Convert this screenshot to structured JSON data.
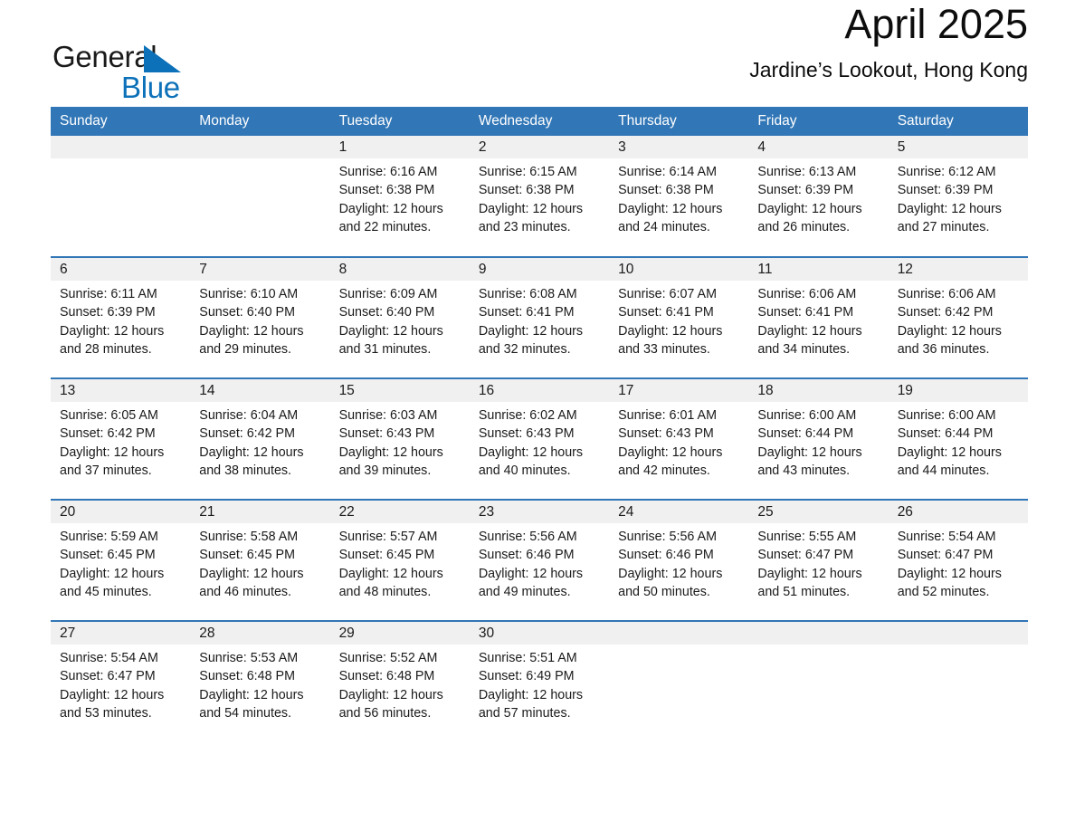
{
  "brand": {
    "name_part1": "General",
    "name_part2": "Blue",
    "accent_color": "#0c71b9"
  },
  "header": {
    "title": "April 2025",
    "location": "Jardine’s Lookout, Hong Kong",
    "header_bg_color": "#3176b6",
    "daynum_bg_color": "#f0f0f0"
  },
  "weekday_headers": [
    "Sunday",
    "Monday",
    "Tuesday",
    "Wednesday",
    "Thursday",
    "Friday",
    "Saturday"
  ],
  "weeks": [
    [
      {
        "day": "",
        "empty": true
      },
      {
        "day": "",
        "empty": true
      },
      {
        "day": "1",
        "sunrise": "Sunrise: 6:16 AM",
        "sunset": "Sunset: 6:38 PM",
        "daylight": "Daylight: 12 hours and 22 minutes.",
        "text": "Sunrise: 6:16 AM\nSunset: 6:38 PM\nDaylight: 12 hours\nand 22 minutes."
      },
      {
        "day": "2",
        "sunrise": "Sunrise: 6:15 AM",
        "sunset": "Sunset: 6:38 PM",
        "daylight": "Daylight: 12 hours and 23 minutes.",
        "text": "Sunrise: 6:15 AM\nSunset: 6:38 PM\nDaylight: 12 hours\nand 23 minutes."
      },
      {
        "day": "3",
        "sunrise": "Sunrise: 6:14 AM",
        "sunset": "Sunset: 6:38 PM",
        "daylight": "Daylight: 12 hours and 24 minutes.",
        "text": "Sunrise: 6:14 AM\nSunset: 6:38 PM\nDaylight: 12 hours\nand 24 minutes."
      },
      {
        "day": "4",
        "sunrise": "Sunrise: 6:13 AM",
        "sunset": "Sunset: 6:39 PM",
        "daylight": "Daylight: 12 hours and 26 minutes.",
        "text": "Sunrise: 6:13 AM\nSunset: 6:39 PM\nDaylight: 12 hours\nand 26 minutes."
      },
      {
        "day": "5",
        "sunrise": "Sunrise: 6:12 AM",
        "sunset": "Sunset: 6:39 PM",
        "daylight": "Daylight: 12 hours and 27 minutes.",
        "text": "Sunrise: 6:12 AM\nSunset: 6:39 PM\nDaylight: 12 hours\nand 27 minutes."
      }
    ],
    [
      {
        "day": "6",
        "sunrise": "Sunrise: 6:11 AM",
        "sunset": "Sunset: 6:39 PM",
        "daylight": "Daylight: 12 hours and 28 minutes.",
        "text": "Sunrise: 6:11 AM\nSunset: 6:39 PM\nDaylight: 12 hours\nand 28 minutes."
      },
      {
        "day": "7",
        "sunrise": "Sunrise: 6:10 AM",
        "sunset": "Sunset: 6:40 PM",
        "daylight": "Daylight: 12 hours and 29 minutes.",
        "text": "Sunrise: 6:10 AM\nSunset: 6:40 PM\nDaylight: 12 hours\nand 29 minutes."
      },
      {
        "day": "8",
        "sunrise": "Sunrise: 6:09 AM",
        "sunset": "Sunset: 6:40 PM",
        "daylight": "Daylight: 12 hours and 31 minutes.",
        "text": "Sunrise: 6:09 AM\nSunset: 6:40 PM\nDaylight: 12 hours\nand 31 minutes."
      },
      {
        "day": "9",
        "sunrise": "Sunrise: 6:08 AM",
        "sunset": "Sunset: 6:41 PM",
        "daylight": "Daylight: 12 hours and 32 minutes.",
        "text": "Sunrise: 6:08 AM\nSunset: 6:41 PM\nDaylight: 12 hours\nand 32 minutes."
      },
      {
        "day": "10",
        "sunrise": "Sunrise: 6:07 AM",
        "sunset": "Sunset: 6:41 PM",
        "daylight": "Daylight: 12 hours and 33 minutes.",
        "text": "Sunrise: 6:07 AM\nSunset: 6:41 PM\nDaylight: 12 hours\nand 33 minutes."
      },
      {
        "day": "11",
        "sunrise": "Sunrise: 6:06 AM",
        "sunset": "Sunset: 6:41 PM",
        "daylight": "Daylight: 12 hours and 34 minutes.",
        "text": "Sunrise: 6:06 AM\nSunset: 6:41 PM\nDaylight: 12 hours\nand 34 minutes."
      },
      {
        "day": "12",
        "sunrise": "Sunrise: 6:06 AM",
        "sunset": "Sunset: 6:42 PM",
        "daylight": "Daylight: 12 hours and 36 minutes.",
        "text": "Sunrise: 6:06 AM\nSunset: 6:42 PM\nDaylight: 12 hours\nand 36 minutes."
      }
    ],
    [
      {
        "day": "13",
        "sunrise": "Sunrise: 6:05 AM",
        "sunset": "Sunset: 6:42 PM",
        "daylight": "Daylight: 12 hours and 37 minutes.",
        "text": "Sunrise: 6:05 AM\nSunset: 6:42 PM\nDaylight: 12 hours\nand 37 minutes."
      },
      {
        "day": "14",
        "sunrise": "Sunrise: 6:04 AM",
        "sunset": "Sunset: 6:42 PM",
        "daylight": "Daylight: 12 hours and 38 minutes.",
        "text": "Sunrise: 6:04 AM\nSunset: 6:42 PM\nDaylight: 12 hours\nand 38 minutes."
      },
      {
        "day": "15",
        "sunrise": "Sunrise: 6:03 AM",
        "sunset": "Sunset: 6:43 PM",
        "daylight": "Daylight: 12 hours and 39 minutes.",
        "text": "Sunrise: 6:03 AM\nSunset: 6:43 PM\nDaylight: 12 hours\nand 39 minutes."
      },
      {
        "day": "16",
        "sunrise": "Sunrise: 6:02 AM",
        "sunset": "Sunset: 6:43 PM",
        "daylight": "Daylight: 12 hours and 40 minutes.",
        "text": "Sunrise: 6:02 AM\nSunset: 6:43 PM\nDaylight: 12 hours\nand 40 minutes."
      },
      {
        "day": "17",
        "sunrise": "Sunrise: 6:01 AM",
        "sunset": "Sunset: 6:43 PM",
        "daylight": "Daylight: 12 hours and 42 minutes.",
        "text": "Sunrise: 6:01 AM\nSunset: 6:43 PM\nDaylight: 12 hours\nand 42 minutes."
      },
      {
        "day": "18",
        "sunrise": "Sunrise: 6:00 AM",
        "sunset": "Sunset: 6:44 PM",
        "daylight": "Daylight: 12 hours and 43 minutes.",
        "text": "Sunrise: 6:00 AM\nSunset: 6:44 PM\nDaylight: 12 hours\nand 43 minutes."
      },
      {
        "day": "19",
        "sunrise": "Sunrise: 6:00 AM",
        "sunset": "Sunset: 6:44 PM",
        "daylight": "Daylight: 12 hours and 44 minutes.",
        "text": "Sunrise: 6:00 AM\nSunset: 6:44 PM\nDaylight: 12 hours\nand 44 minutes."
      }
    ],
    [
      {
        "day": "20",
        "sunrise": "Sunrise: 5:59 AM",
        "sunset": "Sunset: 6:45 PM",
        "daylight": "Daylight: 12 hours and 45 minutes.",
        "text": "Sunrise: 5:59 AM\nSunset: 6:45 PM\nDaylight: 12 hours\nand 45 minutes."
      },
      {
        "day": "21",
        "sunrise": "Sunrise: 5:58 AM",
        "sunset": "Sunset: 6:45 PM",
        "daylight": "Daylight: 12 hours and 46 minutes.",
        "text": "Sunrise: 5:58 AM\nSunset: 6:45 PM\nDaylight: 12 hours\nand 46 minutes."
      },
      {
        "day": "22",
        "sunrise": "Sunrise: 5:57 AM",
        "sunset": "Sunset: 6:45 PM",
        "daylight": "Daylight: 12 hours and 48 minutes.",
        "text": "Sunrise: 5:57 AM\nSunset: 6:45 PM\nDaylight: 12 hours\nand 48 minutes."
      },
      {
        "day": "23",
        "sunrise": "Sunrise: 5:56 AM",
        "sunset": "Sunset: 6:46 PM",
        "daylight": "Daylight: 12 hours and 49 minutes.",
        "text": "Sunrise: 5:56 AM\nSunset: 6:46 PM\nDaylight: 12 hours\nand 49 minutes."
      },
      {
        "day": "24",
        "sunrise": "Sunrise: 5:56 AM",
        "sunset": "Sunset: 6:46 PM",
        "daylight": "Daylight: 12 hours and 50 minutes.",
        "text": "Sunrise: 5:56 AM\nSunset: 6:46 PM\nDaylight: 12 hours\nand 50 minutes."
      },
      {
        "day": "25",
        "sunrise": "Sunrise: 5:55 AM",
        "sunset": "Sunset: 6:47 PM",
        "daylight": "Daylight: 12 hours and 51 minutes.",
        "text": "Sunrise: 5:55 AM\nSunset: 6:47 PM\nDaylight: 12 hours\nand 51 minutes."
      },
      {
        "day": "26",
        "sunrise": "Sunrise: 5:54 AM",
        "sunset": "Sunset: 6:47 PM",
        "daylight": "Daylight: 12 hours and 52 minutes.",
        "text": "Sunrise: 5:54 AM\nSunset: 6:47 PM\nDaylight: 12 hours\nand 52 minutes."
      }
    ],
    [
      {
        "day": "27",
        "sunrise": "Sunrise: 5:54 AM",
        "sunset": "Sunset: 6:47 PM",
        "daylight": "Daylight: 12 hours and 53 minutes.",
        "text": "Sunrise: 5:54 AM\nSunset: 6:47 PM\nDaylight: 12 hours\nand 53 minutes."
      },
      {
        "day": "28",
        "sunrise": "Sunrise: 5:53 AM",
        "sunset": "Sunset: 6:48 PM",
        "daylight": "Daylight: 12 hours and 54 minutes.",
        "text": "Sunrise: 5:53 AM\nSunset: 6:48 PM\nDaylight: 12 hours\nand 54 minutes."
      },
      {
        "day": "29",
        "sunrise": "Sunrise: 5:52 AM",
        "sunset": "Sunset: 6:48 PM",
        "daylight": "Daylight: 12 hours and 56 minutes.",
        "text": "Sunrise: 5:52 AM\nSunset: 6:48 PM\nDaylight: 12 hours\nand 56 minutes."
      },
      {
        "day": "30",
        "sunrise": "Sunrise: 5:51 AM",
        "sunset": "Sunset: 6:49 PM",
        "daylight": "Daylight: 12 hours and 57 minutes.",
        "text": "Sunrise: 5:51 AM\nSunset: 6:49 PM\nDaylight: 12 hours\nand 57 minutes."
      },
      {
        "day": "",
        "empty": true
      },
      {
        "day": "",
        "empty": true
      },
      {
        "day": "",
        "empty": true
      }
    ]
  ]
}
